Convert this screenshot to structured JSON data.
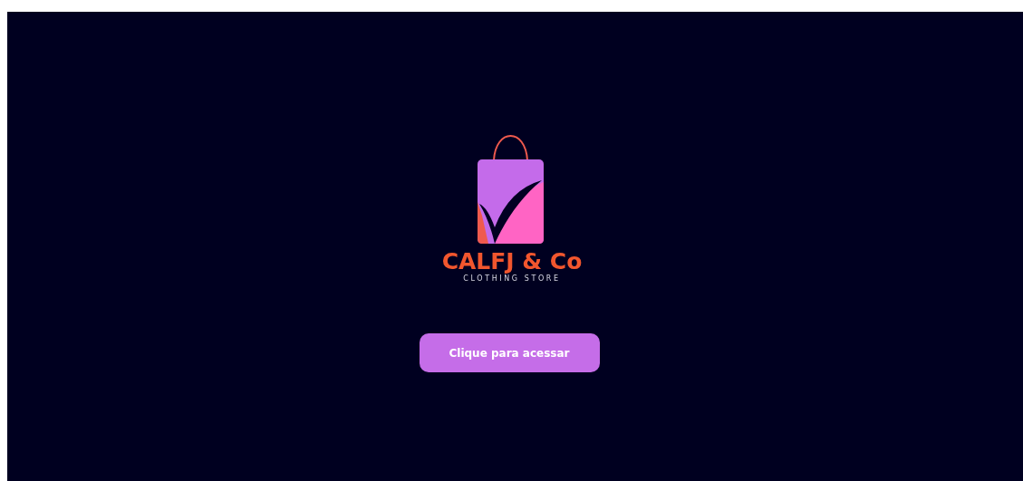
{
  "logo": {
    "name": "CALFJ & Co",
    "tagline": "CLOTHING STORE"
  },
  "button": {
    "label": "Clique para acessar"
  }
}
